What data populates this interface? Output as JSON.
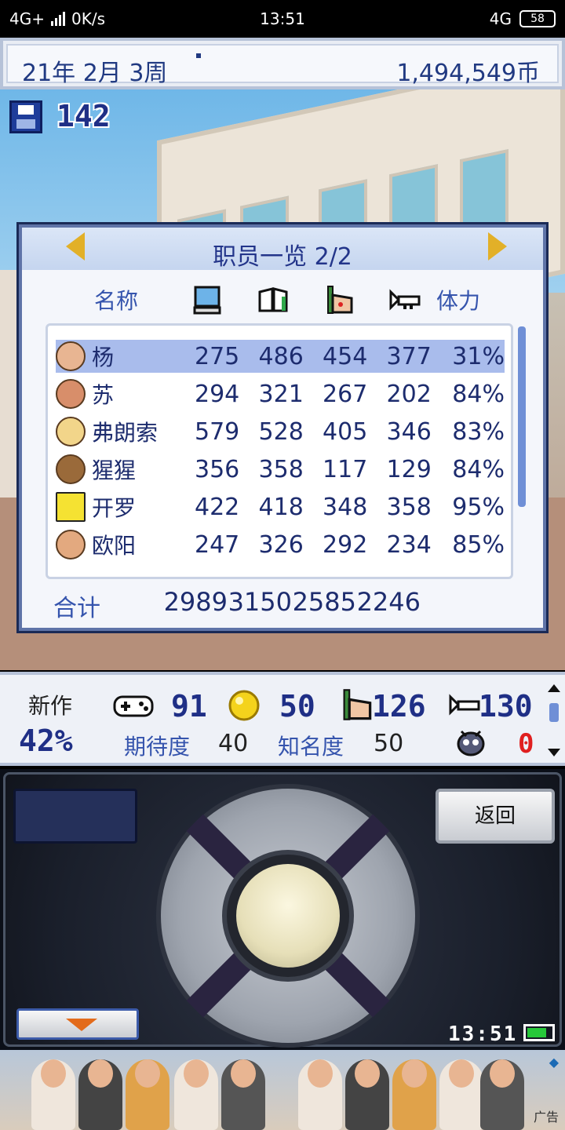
{
  "status_bar": {
    "network": "4G+",
    "speed": "0K/s",
    "time": "13:51",
    "network_right": "4G",
    "battery": "58"
  },
  "top_bar": {
    "date": "21年 2月 3周",
    "money": "1,494,549币"
  },
  "scene": {
    "save_count": "142"
  },
  "staff_panel": {
    "title": "职员一览 2/2",
    "header_name": "名称",
    "header_stamina": "体力",
    "stat_icons": [
      "computer-icon",
      "book-icon",
      "paint-icon",
      "trumpet-icon"
    ],
    "rows": [
      {
        "name": "杨",
        "v1": "275",
        "v2": "486",
        "v3": "454",
        "v4": "377",
        "stamina": "31%",
        "selected": true
      },
      {
        "name": "苏",
        "v1": "294",
        "v2": "321",
        "v3": "267",
        "v4": "202",
        "stamina": "84%",
        "selected": false
      },
      {
        "name": "弗朗索",
        "v1": "579",
        "v2": "528",
        "v3": "405",
        "v4": "346",
        "stamina": "83%",
        "selected": false
      },
      {
        "name": "猩猩",
        "v1": "356",
        "v2": "358",
        "v3": "117",
        "v4": "129",
        "stamina": "84%",
        "selected": false
      },
      {
        "name": "开罗",
        "v1": "422",
        "v2": "418",
        "v3": "348",
        "v4": "358",
        "stamina": "95%",
        "selected": false
      },
      {
        "name": "欧阳",
        "v1": "247",
        "v2": "326",
        "v3": "292",
        "v4": "234",
        "stamina": "85%",
        "selected": false
      }
    ],
    "total_label": "合计",
    "totals": [
      "2989",
      "3150",
      "2585",
      "2246"
    ]
  },
  "info_strip": {
    "new_title_label": "新作",
    "progress": "42%",
    "fun": "91",
    "creativity": "50",
    "graphics": "126",
    "sound": "130",
    "expectation_label": "期待度",
    "expectation_value": "40",
    "fame_label": "知名度",
    "fame_value": "50",
    "bugs": "0"
  },
  "controller": {
    "back_label": "返回",
    "clock": "13:51"
  },
  "ad": {
    "tag": "广告"
  },
  "colors": {
    "title_blue": "#23358a",
    "header_blue": "#3554ad",
    "selected_row": "#a9bcec",
    "bug_red": "#e01f1f"
  }
}
